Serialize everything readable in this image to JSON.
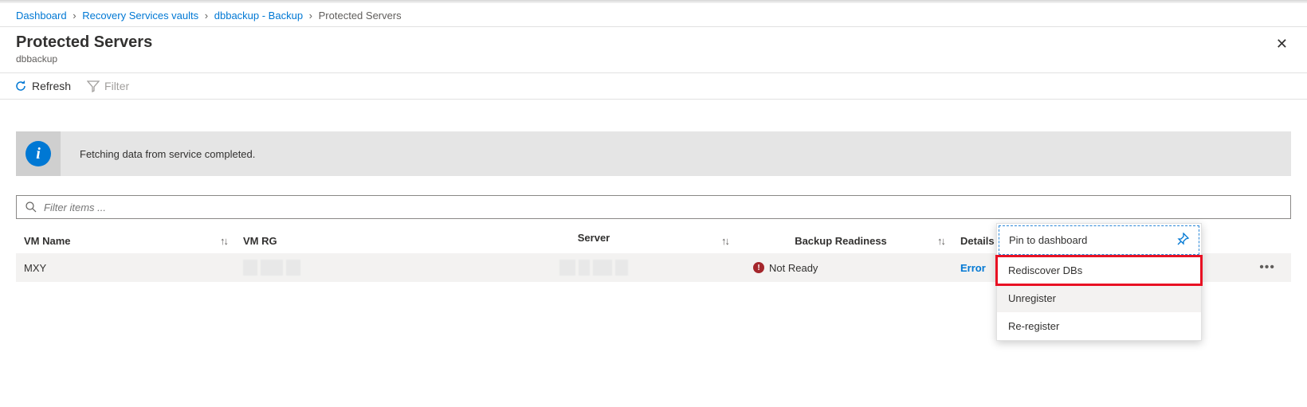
{
  "breadcrumb": {
    "items": [
      {
        "label": "Dashboard",
        "link": true
      },
      {
        "label": "Recovery Services vaults",
        "link": true
      },
      {
        "label": "dbbackup - Backup",
        "link": true
      },
      {
        "label": "Protected Servers",
        "link": false
      }
    ]
  },
  "header": {
    "title": "Protected Servers",
    "subtitle": "dbbackup"
  },
  "toolbar": {
    "refresh": "Refresh",
    "filter": "Filter"
  },
  "notification": {
    "message": "Fetching data from service completed."
  },
  "filter": {
    "placeholder": "Filter items ..."
  },
  "table": {
    "headers": {
      "vm_name": "VM Name",
      "vm_rg": "VM RG",
      "server": "Server",
      "backup_readiness": "Backup Readiness",
      "details": "Details"
    },
    "rows": [
      {
        "vm_name": "MXY",
        "vm_rg": "",
        "server": "",
        "backup_readiness": "Not Ready",
        "details": "Error"
      }
    ]
  },
  "context_menu": {
    "pin": "Pin to dashboard",
    "rediscover": "Rediscover DBs",
    "unregister": "Unregister",
    "reregister": "Re-register"
  }
}
